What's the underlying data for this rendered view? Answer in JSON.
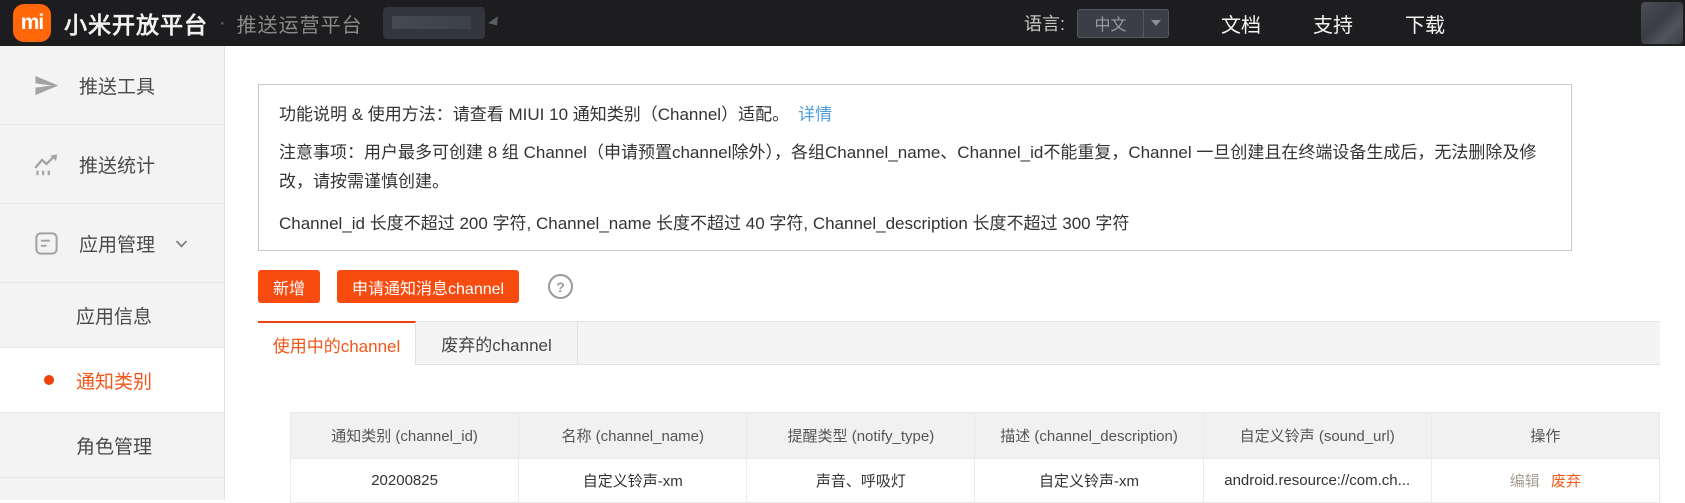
{
  "colors": {
    "topbar_bg": "#1d1d20",
    "brand_orange": "#ff6709",
    "button_orange": "#f84b10",
    "active_orange": "#f25618",
    "link_blue": "#4d9de0",
    "discard_orange": "#f25a1e",
    "sidebar_bg": "#f3f3f4"
  },
  "icons": {
    "mi-logo": "mi",
    "question-mark-icon": "?",
    "paper-plane-icon": "send",
    "chart-icon": "trending-up",
    "apps-icon": "app-window",
    "chevron-down-icon": "chevron-down",
    "caret-down-icon": "triangle-down",
    "active-dot-icon": "circle"
  },
  "header": {
    "brand": "小米开放平台",
    "separator": "·",
    "subtitle": "推送运营平台",
    "language_label": "语言:",
    "language_value": "中文",
    "nav": [
      {
        "label": "文档"
      },
      {
        "label": "支持"
      },
      {
        "label": "下载"
      }
    ]
  },
  "sidebar": {
    "items": [
      {
        "label": "推送工具",
        "icon": "paper-plane-icon"
      },
      {
        "label": "推送统计",
        "icon": "chart-icon"
      },
      {
        "label": "应用管理",
        "icon": "apps-icon",
        "expandable": true
      },
      {
        "label": "应用信息",
        "sub": true
      },
      {
        "label": "通知类别",
        "sub": true,
        "active": true
      },
      {
        "label": "角色管理",
        "sub": true
      }
    ]
  },
  "notice": {
    "line1": "功能说明 & 使用方法：请查看 MIUI 10 通知类别（Channel）适配。",
    "line1_link": "详情",
    "line2": "注意事项：用户最多可创建 8 组 Channel（申请预置channel除外），各组Channel_name、Channel_id不能重复，Channel 一旦创建且在终端设备生成后，无法删除及修改，请按需谨慎创建。",
    "line3": "Channel_id 长度不超过 200 字符, Channel_name 长度不超过 40 字符, Channel_description 长度不超过 300 字符"
  },
  "toolbar": {
    "add_label": "新增",
    "apply_label": "申请通知消息channel"
  },
  "tabs": [
    {
      "label": "使用中的channel",
      "active": true
    },
    {
      "label": "废弃的channel",
      "active": false
    }
  ],
  "table": {
    "headers": [
      "通知类别 (channel_id)",
      "名称 (channel_name)",
      "提醒类型 (notify_type)",
      "描述 (channel_description)",
      "自定义铃声 (sound_url)",
      "操作"
    ],
    "rows": [
      {
        "channel_id": "20200825",
        "channel_name": "自定义铃声-xm",
        "notify_type": "声音、呼吸灯",
        "channel_description": "自定义铃声-xm",
        "sound_url": "android.resource://com.ch...",
        "actions": [
          {
            "label": "编辑"
          },
          {
            "label": "废弃"
          }
        ]
      }
    ]
  }
}
